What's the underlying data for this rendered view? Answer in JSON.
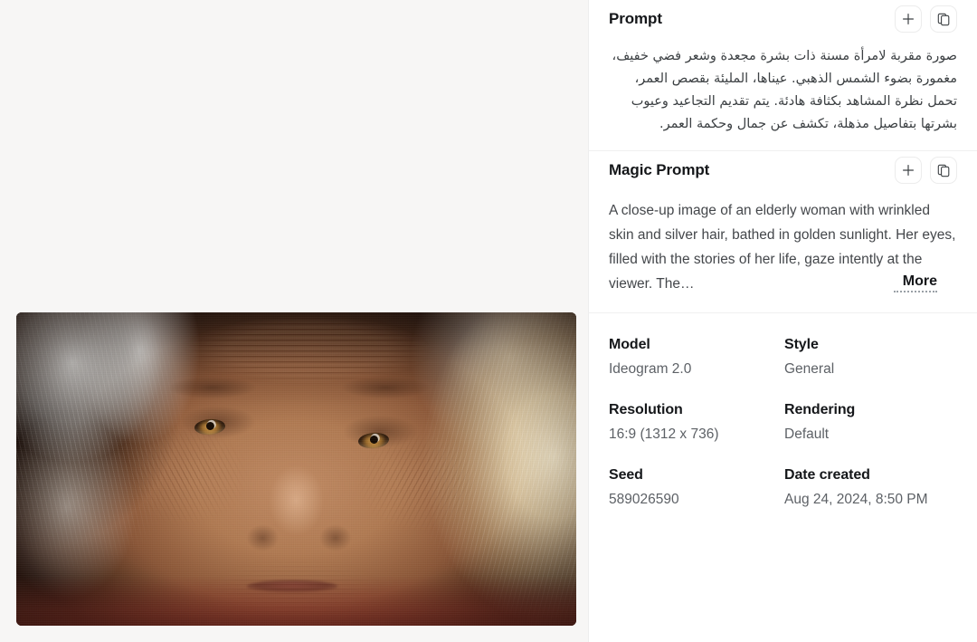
{
  "image_viewer": {
    "alt": "close-up portrait of an elderly woman with wrinkled skin and silver hair in golden sunlight"
  },
  "details": {
    "prompt_section": {
      "title": "Prompt",
      "text": "صورة مقربة لامرأة مسنة ذات بشرة مجعدة وشعر فضي خفيف، مغمورة بضوء الشمس الذهبي. عيناها، المليئة بقصص العمر، تحمل نظرة المشاهد بكثافة هادئة. يتم تقديم التجاعيد وعيوب بشرتها بتفاصيل مذهلة، تكشف عن جمال وحكمة العمر.",
      "add_button": "+",
      "add_icon": "plus-icon",
      "copy_icon": "copy-icon"
    },
    "magic_prompt_section": {
      "title": "Magic Prompt",
      "text": "A close-up image of an elderly woman with wrinkled skin and silver hair, bathed in golden sunlight. Her eyes, filled with the stories of her life, gaze intently at the viewer. The…",
      "more_label": "More",
      "add_button": "+",
      "add_icon": "plus-icon",
      "copy_icon": "copy-icon"
    },
    "metadata": [
      {
        "label": "Model",
        "value": "Ideogram 2.0"
      },
      {
        "label": "Style",
        "value": "General"
      },
      {
        "label": "Resolution",
        "value": "16:9 (1312 x 736)"
      },
      {
        "label": "Rendering",
        "value": "Default"
      },
      {
        "label": "Seed",
        "value": "589026590"
      },
      {
        "label": "Date created",
        "value": "Aug 24, 2024, 8:50 PM"
      }
    ]
  },
  "colors": {
    "page_background": "#f7f6f5",
    "panel_background": "#ffffff",
    "divider": "#f0f0f0",
    "heading_text": "#15171a",
    "body_text": "#44474b",
    "muted_text": "#5d6166"
  }
}
